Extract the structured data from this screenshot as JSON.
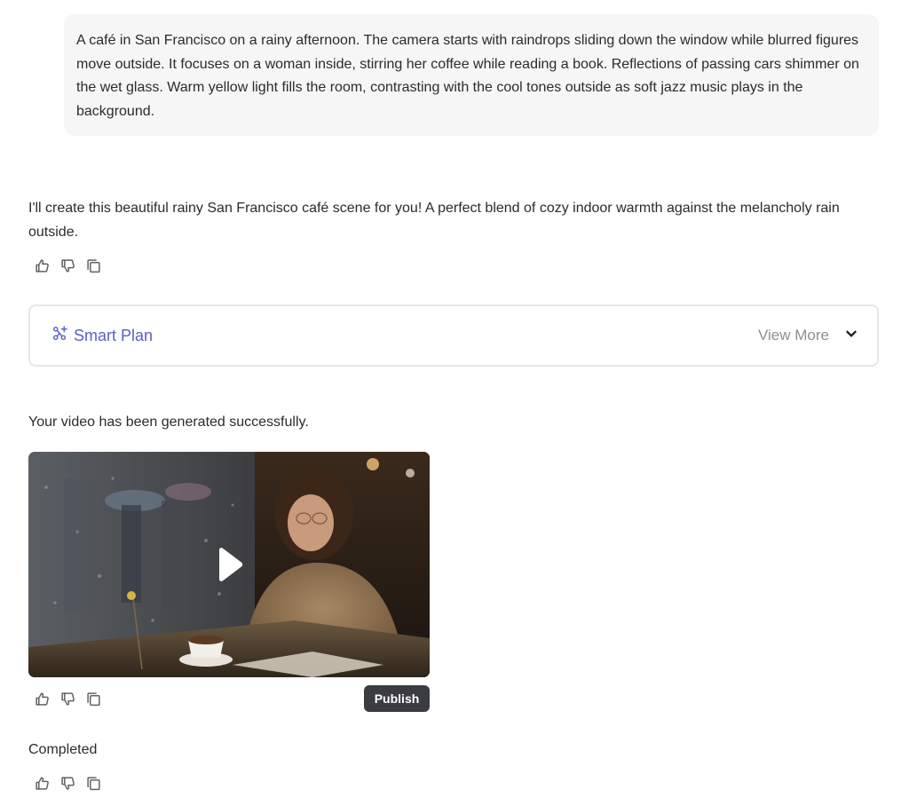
{
  "user_message": {
    "text": "A café in San Francisco on a rainy afternoon. The camera starts with raindrops sliding down the window while blurred figures move outside. It focuses on a woman inside, stirring her coffee while reading a book. Reflections of passing cars shimmer on the wet glass. Warm yellow light fills the room, contrasting with the cool tones outside as soft jazz music plays in the background."
  },
  "assistant_reply": {
    "text": "I'll create this beautiful rainy San Francisco café scene for you! A perfect blend of cozy indoor warmth against the melancholy rain outside.",
    "actions": [
      "thumbs-up-icon",
      "thumbs-down-icon",
      "copy-icon"
    ]
  },
  "smart_plan": {
    "icon": "smart-plan-icon",
    "title": "Smart Plan",
    "view_more_label": "View More",
    "chevron": "chevron-down-icon"
  },
  "video_result": {
    "status_text": "Your video has been generated successfully.",
    "play_icon": "play-icon",
    "publish_label": "Publish"
  },
  "completion": {
    "status_text": "Completed"
  },
  "colors": {
    "accent": "#5b5fc7",
    "bubble_bg": "#f6f6f7",
    "publish_bg": "#3b3c40",
    "muted_text": "#8e8f94"
  }
}
